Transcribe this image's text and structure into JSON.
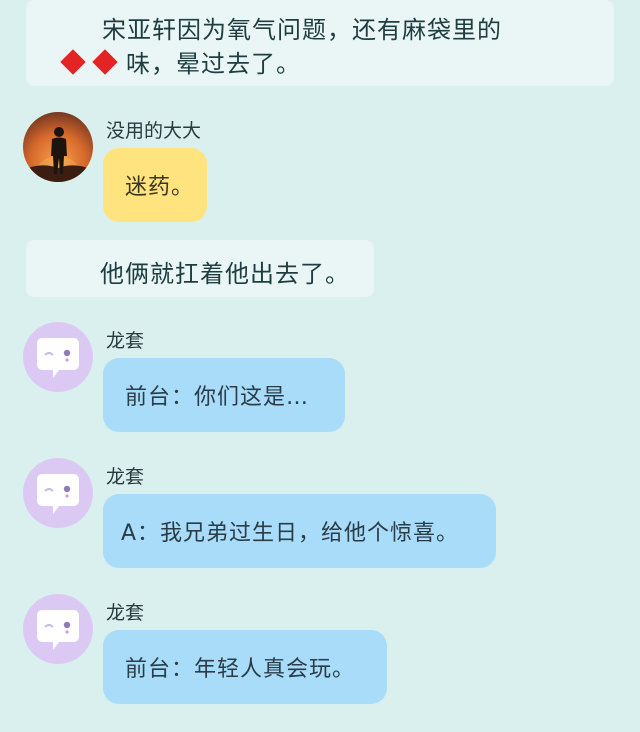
{
  "narration_top": {
    "line1": "宋亚轩因为氧气问题，还有麻袋里的",
    "line2": "味，晕过去了。",
    "emoji": "red-diamond-icon x2"
  },
  "messages": [
    {
      "sender": "没用的大大",
      "text": "迷药。",
      "bubble_color": "#ffe37f",
      "avatar": "person-silhouette-sunset-avatar"
    },
    {
      "sender": "龙套",
      "text": "前台：你们这是…",
      "bubble_color": "#a8dcf8",
      "avatar": "chat-bubble-face-avatar"
    },
    {
      "sender": "龙套",
      "text": "A：我兄弟过生日，给他个惊喜。",
      "bubble_color": "#a8dcf8",
      "avatar": "chat-bubble-face-avatar"
    },
    {
      "sender": "龙套",
      "text": "前台：年轻人真会玩。",
      "bubble_color": "#a8dcf8",
      "avatar": "chat-bubble-face-avatar"
    }
  ],
  "narration_mid": {
    "line1": "他俩就扛着他出去了。"
  }
}
